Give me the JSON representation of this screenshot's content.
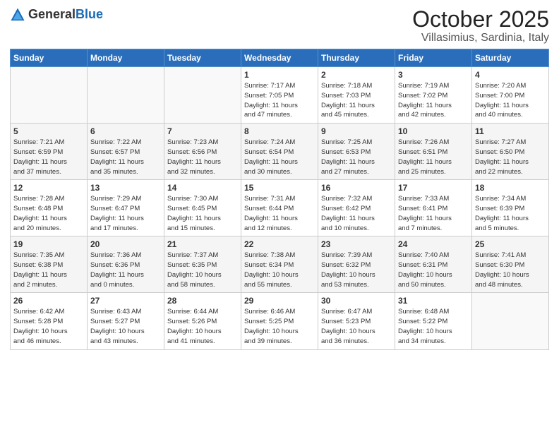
{
  "header": {
    "logo_general": "General",
    "logo_blue": "Blue",
    "month_title": "October 2025",
    "location": "Villasimius, Sardinia, Italy"
  },
  "calendar": {
    "weekdays": [
      "Sunday",
      "Monday",
      "Tuesday",
      "Wednesday",
      "Thursday",
      "Friday",
      "Saturday"
    ],
    "rows": [
      [
        {
          "day": "",
          "info": ""
        },
        {
          "day": "",
          "info": ""
        },
        {
          "day": "",
          "info": ""
        },
        {
          "day": "1",
          "info": "Sunrise: 7:17 AM\nSunset: 7:05 PM\nDaylight: 11 hours\nand 47 minutes."
        },
        {
          "day": "2",
          "info": "Sunrise: 7:18 AM\nSunset: 7:03 PM\nDaylight: 11 hours\nand 45 minutes."
        },
        {
          "day": "3",
          "info": "Sunrise: 7:19 AM\nSunset: 7:02 PM\nDaylight: 11 hours\nand 42 minutes."
        },
        {
          "day": "4",
          "info": "Sunrise: 7:20 AM\nSunset: 7:00 PM\nDaylight: 11 hours\nand 40 minutes."
        }
      ],
      [
        {
          "day": "5",
          "info": "Sunrise: 7:21 AM\nSunset: 6:59 PM\nDaylight: 11 hours\nand 37 minutes."
        },
        {
          "day": "6",
          "info": "Sunrise: 7:22 AM\nSunset: 6:57 PM\nDaylight: 11 hours\nand 35 minutes."
        },
        {
          "day": "7",
          "info": "Sunrise: 7:23 AM\nSunset: 6:56 PM\nDaylight: 11 hours\nand 32 minutes."
        },
        {
          "day": "8",
          "info": "Sunrise: 7:24 AM\nSunset: 6:54 PM\nDaylight: 11 hours\nand 30 minutes."
        },
        {
          "day": "9",
          "info": "Sunrise: 7:25 AM\nSunset: 6:53 PM\nDaylight: 11 hours\nand 27 minutes."
        },
        {
          "day": "10",
          "info": "Sunrise: 7:26 AM\nSunset: 6:51 PM\nDaylight: 11 hours\nand 25 minutes."
        },
        {
          "day": "11",
          "info": "Sunrise: 7:27 AM\nSunset: 6:50 PM\nDaylight: 11 hours\nand 22 minutes."
        }
      ],
      [
        {
          "day": "12",
          "info": "Sunrise: 7:28 AM\nSunset: 6:48 PM\nDaylight: 11 hours\nand 20 minutes."
        },
        {
          "day": "13",
          "info": "Sunrise: 7:29 AM\nSunset: 6:47 PM\nDaylight: 11 hours\nand 17 minutes."
        },
        {
          "day": "14",
          "info": "Sunrise: 7:30 AM\nSunset: 6:45 PM\nDaylight: 11 hours\nand 15 minutes."
        },
        {
          "day": "15",
          "info": "Sunrise: 7:31 AM\nSunset: 6:44 PM\nDaylight: 11 hours\nand 12 minutes."
        },
        {
          "day": "16",
          "info": "Sunrise: 7:32 AM\nSunset: 6:42 PM\nDaylight: 11 hours\nand 10 minutes."
        },
        {
          "day": "17",
          "info": "Sunrise: 7:33 AM\nSunset: 6:41 PM\nDaylight: 11 hours\nand 7 minutes."
        },
        {
          "day": "18",
          "info": "Sunrise: 7:34 AM\nSunset: 6:39 PM\nDaylight: 11 hours\nand 5 minutes."
        }
      ],
      [
        {
          "day": "19",
          "info": "Sunrise: 7:35 AM\nSunset: 6:38 PM\nDaylight: 11 hours\nand 2 minutes."
        },
        {
          "day": "20",
          "info": "Sunrise: 7:36 AM\nSunset: 6:36 PM\nDaylight: 11 hours\nand 0 minutes."
        },
        {
          "day": "21",
          "info": "Sunrise: 7:37 AM\nSunset: 6:35 PM\nDaylight: 10 hours\nand 58 minutes."
        },
        {
          "day": "22",
          "info": "Sunrise: 7:38 AM\nSunset: 6:34 PM\nDaylight: 10 hours\nand 55 minutes."
        },
        {
          "day": "23",
          "info": "Sunrise: 7:39 AM\nSunset: 6:32 PM\nDaylight: 10 hours\nand 53 minutes."
        },
        {
          "day": "24",
          "info": "Sunrise: 7:40 AM\nSunset: 6:31 PM\nDaylight: 10 hours\nand 50 minutes."
        },
        {
          "day": "25",
          "info": "Sunrise: 7:41 AM\nSunset: 6:30 PM\nDaylight: 10 hours\nand 48 minutes."
        }
      ],
      [
        {
          "day": "26",
          "info": "Sunrise: 6:42 AM\nSunset: 5:28 PM\nDaylight: 10 hours\nand 46 minutes."
        },
        {
          "day": "27",
          "info": "Sunrise: 6:43 AM\nSunset: 5:27 PM\nDaylight: 10 hours\nand 43 minutes."
        },
        {
          "day": "28",
          "info": "Sunrise: 6:44 AM\nSunset: 5:26 PM\nDaylight: 10 hours\nand 41 minutes."
        },
        {
          "day": "29",
          "info": "Sunrise: 6:46 AM\nSunset: 5:25 PM\nDaylight: 10 hours\nand 39 minutes."
        },
        {
          "day": "30",
          "info": "Sunrise: 6:47 AM\nSunset: 5:23 PM\nDaylight: 10 hours\nand 36 minutes."
        },
        {
          "day": "31",
          "info": "Sunrise: 6:48 AM\nSunset: 5:22 PM\nDaylight: 10 hours\nand 34 minutes."
        },
        {
          "day": "",
          "info": ""
        }
      ]
    ]
  }
}
